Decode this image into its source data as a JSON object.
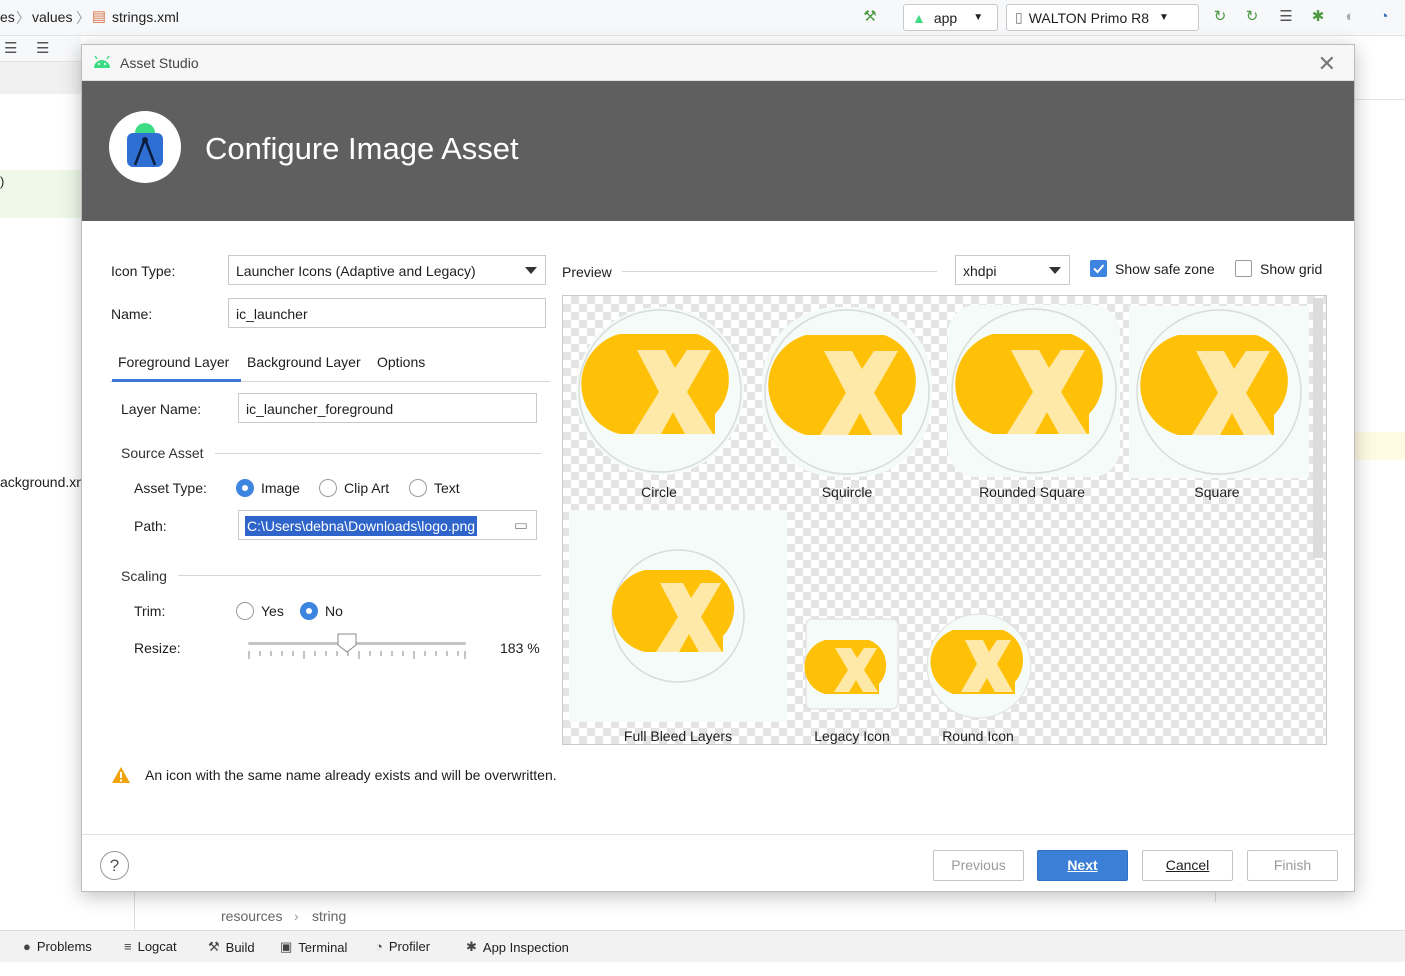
{
  "ide": {
    "breadcrumb": [
      "es",
      "values",
      "strings.xml"
    ],
    "run_config": "app",
    "device": "WALTON Primo R8",
    "left_text_1": ")",
    "left_text_2": "ackground.xn",
    "bottom_breadcrumb": [
      "resources",
      "string"
    ],
    "status_tabs": [
      "Problems",
      "Logcat",
      "Build",
      "Terminal",
      "Profiler",
      "App Inspection"
    ]
  },
  "dialog": {
    "window_title": "Asset Studio",
    "header_title": "Configure Image Asset",
    "icon_type_label": "Icon Type:",
    "icon_type_value": "Launcher Icons (Adaptive and Legacy)",
    "name_label": "Name:",
    "name_value": "ic_launcher",
    "tabs": [
      "Foreground Layer",
      "Background Layer",
      "Options"
    ],
    "layer_name_label": "Layer Name:",
    "layer_name_value": "ic_launcher_foreground",
    "source_asset_title": "Source Asset",
    "asset_type_label": "Asset Type:",
    "asset_type_options": [
      "Image",
      "Clip Art",
      "Text"
    ],
    "asset_type_selected": "Image",
    "path_label": "Path:",
    "path_value": "C:\\Users\\debna\\Downloads\\logo.png",
    "scaling_title": "Scaling",
    "trim_label": "Trim:",
    "trim_options": [
      "Yes",
      "No"
    ],
    "trim_selected": "No",
    "resize_label": "Resize:",
    "resize_value": "183 %",
    "resize_percent": 183,
    "preview_label": "Preview",
    "density_value": "xhdpi",
    "show_safe_zone_label": "Show safe zone",
    "show_safe_zone": true,
    "show_grid_label": "Show grid",
    "show_grid": false,
    "preview_items": [
      "Circle",
      "Squircle",
      "Rounded Square",
      "Square",
      "Full Bleed Layers",
      "Legacy Icon",
      "Round Icon"
    ],
    "warning_text": "An icon with the same name already exists and will be overwritten.",
    "buttons": {
      "previous": "Previous",
      "next": "Next",
      "cancel": "Cancel",
      "finish": "Finish"
    },
    "help": "?",
    "colors": {
      "logo_yellow": "#ffc107",
      "logo_light": "#ffe9a8",
      "accent_blue": "#3b7fd6",
      "header_gray": "#5f5f5f"
    }
  }
}
